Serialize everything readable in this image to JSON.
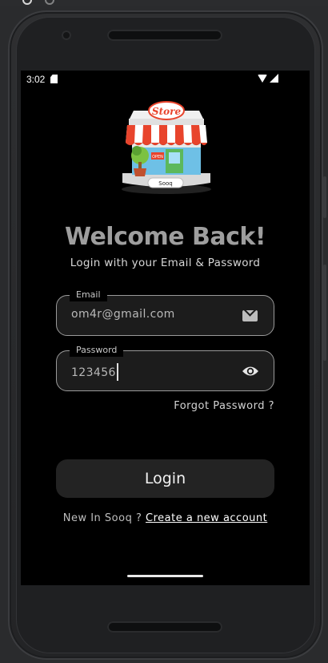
{
  "status_bar": {
    "time": "3:02"
  },
  "app": {
    "store_badge": "Store",
    "sign_text": "Sooq",
    "open_sign": "OPEN"
  },
  "login": {
    "title": "Welcome Back!",
    "subtitle": "Login with your Email & Password",
    "email_label": "Email",
    "email_value": "om4r@gmail.com",
    "password_label": "Password",
    "password_value": "123456",
    "forgot_label": "Forgot Password ?",
    "login_button": "Login",
    "signup_prompt": "New In Sooq ? ",
    "signup_link": "Create a new account"
  },
  "colors": {
    "screen_bg": "#000000",
    "field_bg": "#1c1c1c",
    "title": "#9e9e9e",
    "awning_red": "#e8442c"
  }
}
